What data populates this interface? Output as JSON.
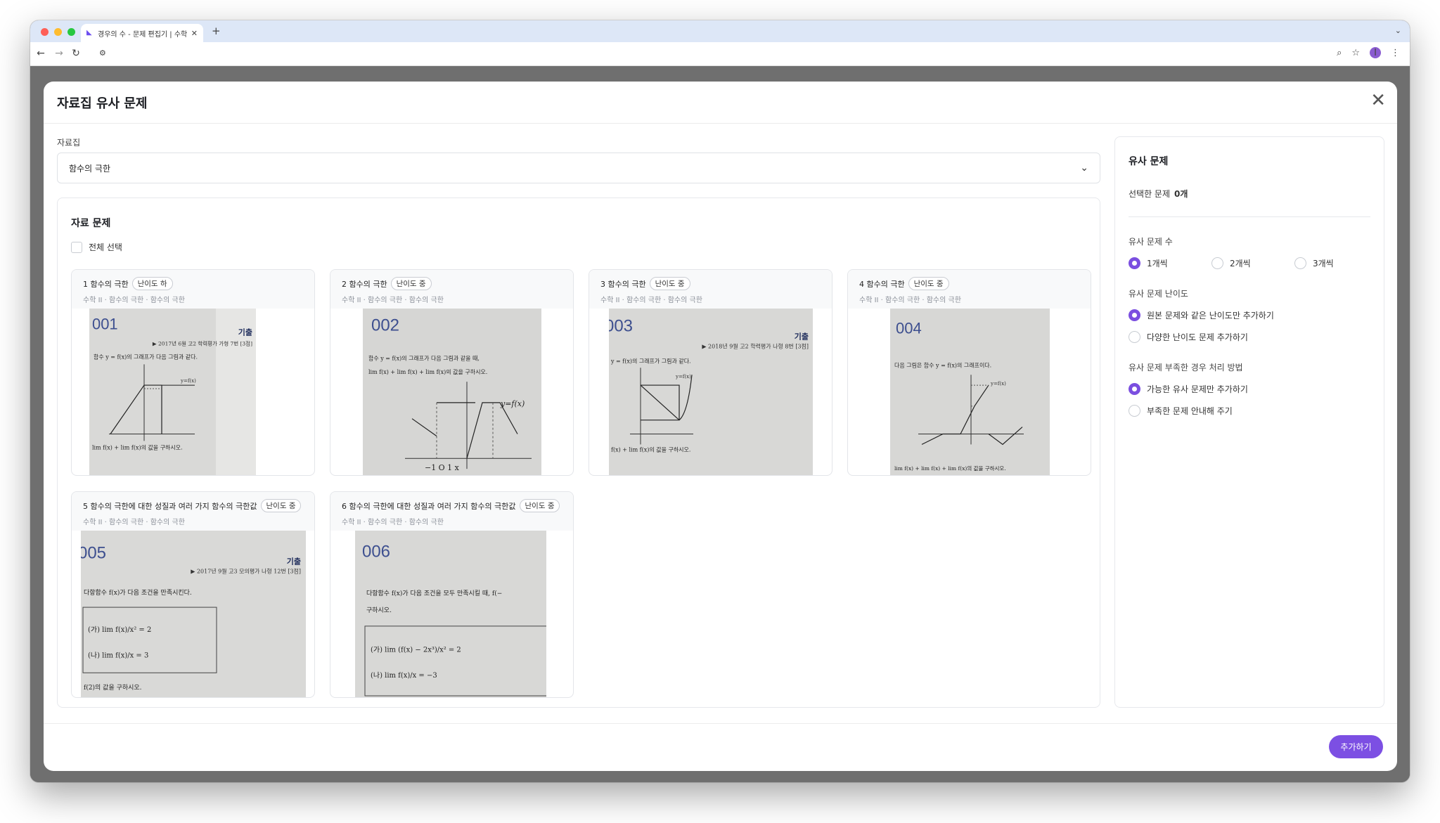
{
  "browser": {
    "tab_title": "경우의 수 - 문제 편집기 | 수학대왕",
    "new_tab_symbol": "+",
    "profile_initial": "I"
  },
  "modal": {
    "title": "자료집 유사 문제",
    "close_symbol": "✕",
    "collection_label": "자료집",
    "collection_value": "함수의 극한",
    "panel_title": "자료 문제",
    "select_all_label": "전체 선택",
    "add_button": "추가하기"
  },
  "cards": [
    {
      "title": "1 함수의 극한",
      "difficulty": "난이도 하",
      "subtitle": "수학 II · 함수의 극한 · 함수의 극한",
      "img": {
        "num": "001",
        "tag": "기출",
        "source": "▶ 2017년 6월 고2 학력평가 가형 7번 [3점]",
        "line1": "함수 y = f(x)의 그래프가 다음 그림과 같다.",
        "line2": "lim f(x) + lim f(x)의 값을 구하시오."
      }
    },
    {
      "title": "2 함수의 극한",
      "difficulty": "난이도 중",
      "subtitle": "수학 II · 함수의 극한 · 함수의 극한",
      "img": {
        "num": "002",
        "line1": "함수 y = f(x)의 그래프가 다음 그림과 같을 때,",
        "line2": "lim f(x) + lim f(x) + lim f(x)의 값을 구하시오."
      }
    },
    {
      "title": "3 함수의 극한",
      "difficulty": "난이도 중",
      "subtitle": "수학 II · 함수의 극한 · 함수의 극한",
      "img": {
        "num": "003",
        "tag": "기출",
        "source": "▶ 2018년 9월 고2 학력평가 나형 8번 [3점]",
        "line1": "y = f(x)의 그래프가 그림과 같다.",
        "line2": "f(x) + lim f(x)의 값을 구하시오."
      }
    },
    {
      "title": "4 함수의 극한",
      "difficulty": "난이도 중",
      "subtitle": "수학 II · 함수의 극한 · 함수의 극한",
      "img": {
        "num": "004",
        "line1": "다음 그림은 함수 y = f(x)의 그래프이다.",
        "line2": "lim f(x) + lim f(x) + lim f(x)의 값을 구하시오."
      }
    },
    {
      "title": "5 함수의 극한에 대한 성질과 여러 가지 함수의 극한값",
      "difficulty": "난이도 중",
      "subtitle": "수학 II · 함수의 극한 · 함수의 극한",
      "img": {
        "num": "005",
        "tag": "기출",
        "source": "▶ 2017년 9월 고3 모의평가 나형 12번 [3점]",
        "line1": "다항함수 f(x)가 다음 조건을 만족시킨다.",
        "cond1": "(가) lim f(x)/x² = 2",
        "cond2": "(나) lim f(x)/x = 3",
        "line2": "f(2)의 값을 구하시오."
      }
    },
    {
      "title": "6 함수의 극한에 대한 성질과 여러 가지 함수의 극한값",
      "difficulty": "난이도 중",
      "subtitle": "수학 II · 함수의 극한 · 함수의 극한",
      "img": {
        "num": "006",
        "line1": "다항함수 f(x)가 다음 조건을 모두 만족시킬 때, f(−",
        "line1b": "구하시오.",
        "cond1": "(가) lim (f(x) − 2x³)/x² = 2",
        "cond2": "(나) lim f(x)/x = −3"
      }
    }
  ],
  "sidebar": {
    "title": "유사 문제",
    "selected_label": "선택한 문제",
    "selected_count": "0개",
    "count_label": "유사 문제 수",
    "count_options": [
      "1개씩",
      "2개씩",
      "3개씩"
    ],
    "count_selected": 0,
    "difficulty_label": "유사 문제 난이도",
    "difficulty_options": [
      "원본 문제와 같은 난이도만 추가하기",
      "다양한 난이도 문제 추가하기"
    ],
    "difficulty_selected": 0,
    "shortage_label": "유사 문제 부족한 경우 처리 방법",
    "shortage_options": [
      "가능한 유사 문제만 추가하기",
      "부족한 문제 안내해 주기"
    ],
    "shortage_selected": 0
  },
  "colors": {
    "accent": "#7c4fe3",
    "number_blue": "#3d4f8f",
    "tag_navy": "#1f2d5c"
  }
}
